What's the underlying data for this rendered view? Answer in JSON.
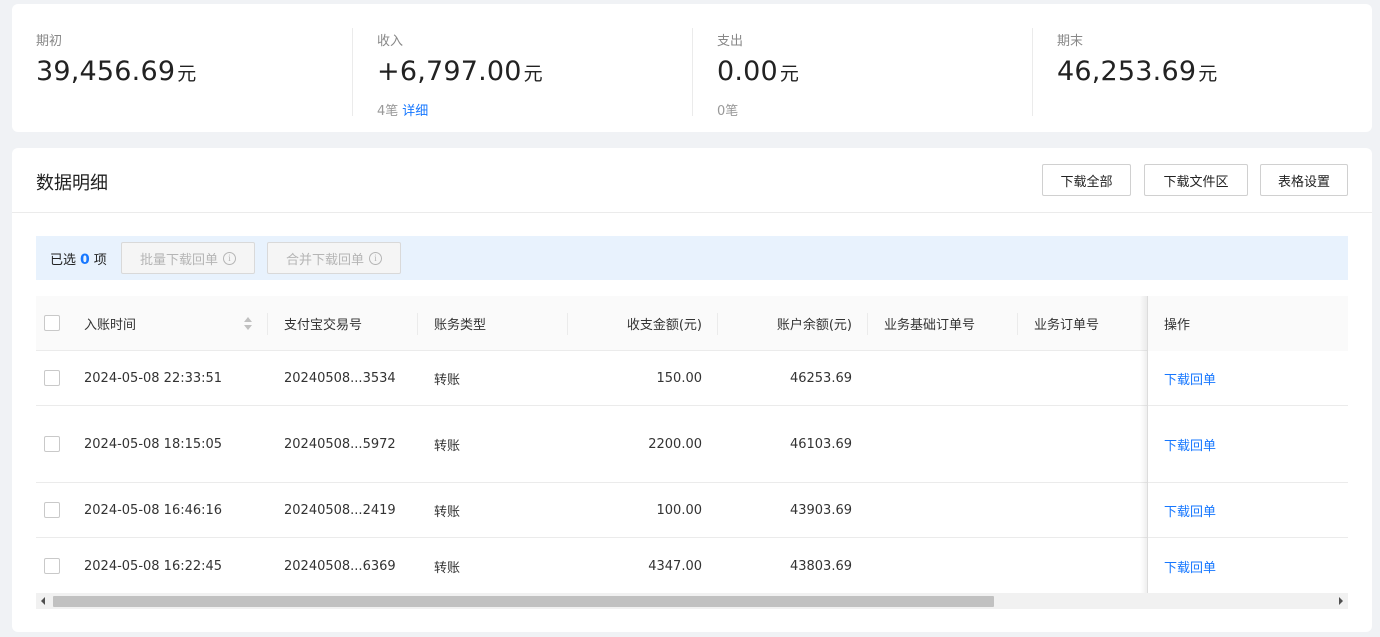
{
  "summary": {
    "opening": {
      "label": "期初",
      "amount": "39,456.69",
      "unit": "元"
    },
    "income": {
      "label": "收入",
      "amount": "+6,797.00",
      "unit": "元",
      "count": "4笔",
      "detail_link": "详细"
    },
    "expense": {
      "label": "支出",
      "amount": "0.00",
      "unit": "元",
      "count": "0笔"
    },
    "closing": {
      "label": "期末",
      "amount": "46,253.69",
      "unit": "元"
    }
  },
  "detail": {
    "title": "数据明细",
    "buttons": {
      "download_all": "下载全部",
      "download_files": "下载文件区",
      "table_settings": "表格设置"
    },
    "selection": {
      "prefix": "已选",
      "count": "0",
      "suffix": "项",
      "batch_download": "批量下载回单",
      "merge_download": "合并下载回单"
    },
    "columns": {
      "time": "入账时间",
      "trade_no": "支付宝交易号",
      "type": "账务类型",
      "amount": "收支金额(元)",
      "balance": "账户余额(元)",
      "base_order": "业务基础订单号",
      "order": "业务订单号",
      "action": "操作"
    },
    "rows": [
      {
        "time": "2024-05-08 22:33:51",
        "trade_no": "20240508...3534",
        "type": "转账",
        "amount": "150.00",
        "balance": "46253.69",
        "action": "下载回单"
      },
      {
        "time": "2024-05-08 18:15:05",
        "trade_no": "20240508...5972",
        "type": "转账",
        "amount": "2200.00",
        "balance": "46103.69",
        "action": "下载回单"
      },
      {
        "time": "2024-05-08 16:46:16",
        "trade_no": "20240508...2419",
        "type": "转账",
        "amount": "100.00",
        "balance": "43903.69",
        "action": "下载回单"
      },
      {
        "time": "2024-05-08 16:22:45",
        "trade_no": "20240508...6369",
        "type": "转账",
        "amount": "4347.00",
        "balance": "43803.69",
        "action": "下载回单"
      }
    ]
  },
  "colors": {
    "link": "#1677ff",
    "selection_bar": "#e8f2fd",
    "page_bg": "#f0f2f5"
  },
  "icons": {
    "sort": "sort-icon",
    "info": "info-circle-icon",
    "scroll_left": "arrow-left-icon",
    "scroll_right": "arrow-right-icon"
  }
}
